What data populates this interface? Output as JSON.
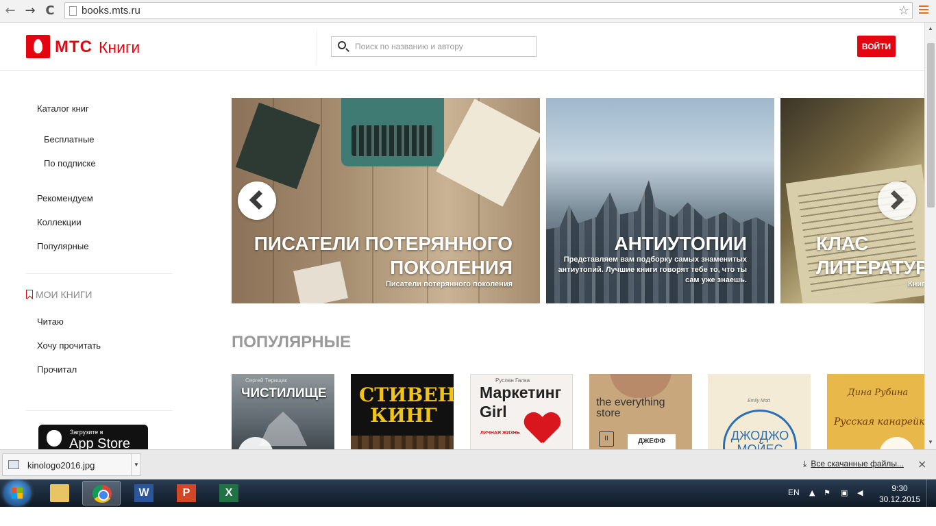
{
  "browser": {
    "url": "books.mts.ru",
    "back_icon": "←",
    "forward_icon": "→",
    "reload_icon": "C",
    "star_icon": "☆"
  },
  "header": {
    "logo_mts": "МТС",
    "logo_books": "Книги",
    "search_placeholder": "Поиск по названию и автору",
    "login_label": "ВОЙТИ",
    "brand_color": "#e30611"
  },
  "sidebar": {
    "catalog": "Каталог книг",
    "free": "Бесплатные",
    "subscription": "По подписке",
    "recommend": "Рекомендуем",
    "collections": "Коллекции",
    "popular": "Популярные",
    "my_books": "МОИ КНИГИ",
    "reading": "Читаю",
    "want_to_read": "Хочу прочитать",
    "read": "Прочитал",
    "appstore_small": "Загрузите в",
    "appstore_big": "App Store"
  },
  "slider": {
    "slides": [
      {
        "title": "ПИСАТЕЛИ ПОТЕРЯННОГО ПОКОЛЕНИЯ",
        "subtitle": "Писатели потерянного поколения"
      },
      {
        "title": "АНТИУТОПИИ",
        "subtitle": "Представляем вам подборку самых знаменитых антиутопий. Лучшие книги говорят тебе то, что ты сам уже знаешь."
      },
      {
        "title": "КЛАС ЛИТЕРАТУР",
        "subtitle": "Книг"
      }
    ]
  },
  "popular": {
    "title": "ПОПУЛЯРНЫЕ",
    "books": [
      {
        "author": "Сергей Терищак",
        "title": "ЧИСТИЛИЩЕ"
      },
      {
        "author": "",
        "title": "СТИВЕН КИНГ"
      },
      {
        "author": "Руслан Галка",
        "title": "Маркетинг Girl",
        "extra": "ЛИЧНАЯ ЖИЗНЬ"
      },
      {
        "author": "the everything store",
        "title": "ДЖЕФФ"
      },
      {
        "author": "Emily Mott",
        "title": "ДЖОДЖО МОЙЕС"
      },
      {
        "author": "Дина Рубина",
        "title": "Русская канарейка"
      }
    ]
  },
  "downloads": {
    "file": "kinologo2016.jpg",
    "all": "Все скачанные файлы...",
    "close": "×"
  },
  "taskbar": {
    "lang": "EN",
    "time": "9:30",
    "date": "30.12.2015",
    "apps": [
      "folder-icon",
      "chrome-icon",
      "word-icon",
      "powerpoint-icon",
      "excel-icon"
    ]
  }
}
